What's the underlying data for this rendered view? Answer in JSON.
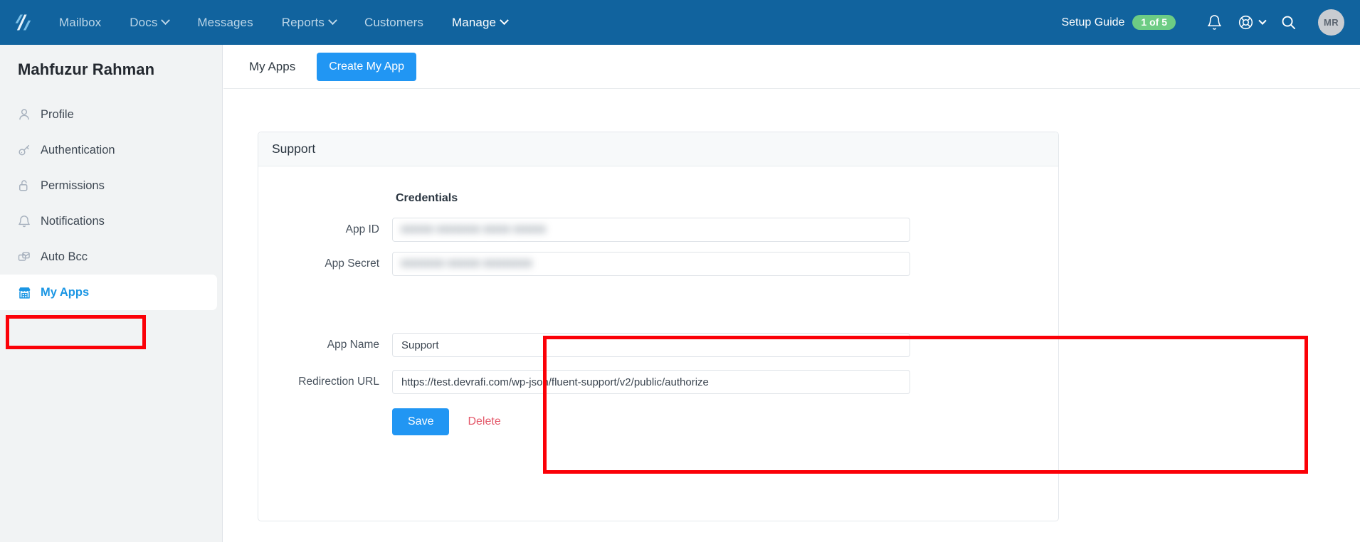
{
  "topnav": {
    "logo_name": "helpscout-logo",
    "links": [
      {
        "label": "Mailbox",
        "caret": false,
        "active": false
      },
      {
        "label": "Docs",
        "caret": true,
        "active": false
      },
      {
        "label": "Messages",
        "caret": false,
        "active": false
      },
      {
        "label": "Reports",
        "caret": true,
        "active": false
      },
      {
        "label": "Customers",
        "caret": false,
        "active": false
      },
      {
        "label": "Manage",
        "caret": true,
        "active": true
      }
    ],
    "setup_guide_label": "Setup Guide",
    "setup_guide_badge": "1 of 5",
    "badge_color": "#6dcc84",
    "bar_color": "#11639e",
    "avatar_initials": "MR"
  },
  "sidebar": {
    "title": "Mahfuzur Rahman",
    "items": [
      {
        "label": "Profile",
        "icon": "user-icon",
        "active": false
      },
      {
        "label": "Authentication",
        "icon": "key-icon",
        "active": false
      },
      {
        "label": "Permissions",
        "icon": "unlock-icon",
        "active": false
      },
      {
        "label": "Notifications",
        "icon": "bell-icon",
        "active": false
      },
      {
        "label": "Auto Bcc",
        "icon": "envelope-copy-icon",
        "active": false
      },
      {
        "label": "My Apps",
        "icon": "storefront-icon",
        "active": true
      }
    ]
  },
  "tabs": {
    "my_apps_label": "My Apps",
    "create_button_label": "Create My App"
  },
  "card": {
    "header_title": "Support",
    "credentials_heading": "Credentials",
    "fields": [
      {
        "label": "App ID",
        "value": "▮▮▮▮▮▮ ▮▮▮▮▮▮▮▮ ▮▮▮▮▮ ▮▮▮▮▮▮",
        "redacted": true
      },
      {
        "label": "App Secret",
        "value": "▮▮▮▮▮▮▮▮ ▮▮▮▮▮▮ ▮▮▮▮▮▮▮▮▮",
        "redacted": true
      },
      {
        "label": "App Name",
        "value": "Support",
        "redacted": false
      },
      {
        "label": "Redirection URL",
        "value": "https://test.devrafi.com/wp-json/fluent-support/v2/public/authorize",
        "redacted": false
      }
    ],
    "save_label": "Save",
    "delete_label": "Delete"
  },
  "annotations": {
    "highlight_color": "#fb0007",
    "credentials_box": "credentials-highlight",
    "myapps_box": "my-apps-highlight"
  }
}
